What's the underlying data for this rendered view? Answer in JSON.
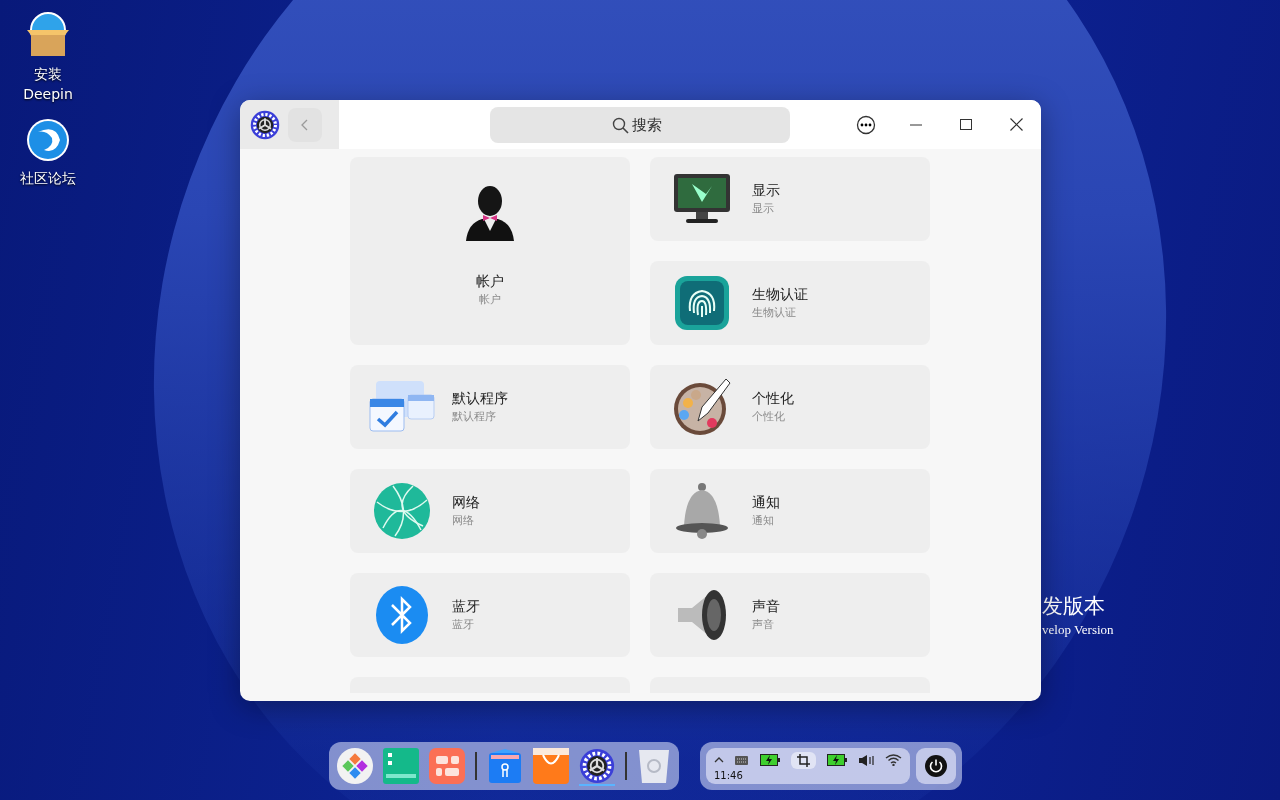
{
  "desktop_icons": [
    {
      "label": "安装 Deepin"
    },
    {
      "label": "社区论坛"
    }
  ],
  "watermark": {
    "title": "发版本",
    "subtitle": "velop Version"
  },
  "window": {
    "search": {
      "placeholder": "搜索"
    }
  },
  "modules": [
    {
      "title": "帐户",
      "subtitle": "帐户",
      "kind": "large"
    },
    {
      "title": "显示",
      "subtitle": "显示",
      "kind": "row"
    },
    {
      "title": "生物认证",
      "subtitle": "生物认证",
      "kind": "row"
    },
    {
      "title": "默认程序",
      "subtitle": "默认程序",
      "kind": "row"
    },
    {
      "title": "个性化",
      "subtitle": "个性化",
      "kind": "row"
    },
    {
      "title": "网络",
      "subtitle": "网络",
      "kind": "row"
    },
    {
      "title": "通知",
      "subtitle": "通知",
      "kind": "row"
    },
    {
      "title": "蓝牙",
      "subtitle": "蓝牙",
      "kind": "row"
    },
    {
      "title": "声音",
      "subtitle": "声音",
      "kind": "row"
    }
  ],
  "dock": [
    {
      "kind": "app",
      "active": false
    },
    {
      "kind": "app",
      "active": false
    },
    {
      "kind": "app",
      "active": false
    },
    {
      "kind": "separator"
    },
    {
      "kind": "app",
      "active": false
    },
    {
      "kind": "app",
      "active": false
    },
    {
      "kind": "app",
      "active": true
    },
    {
      "kind": "separator"
    },
    {
      "kind": "app",
      "active": false
    }
  ],
  "tray": {
    "time": "11:46"
  }
}
